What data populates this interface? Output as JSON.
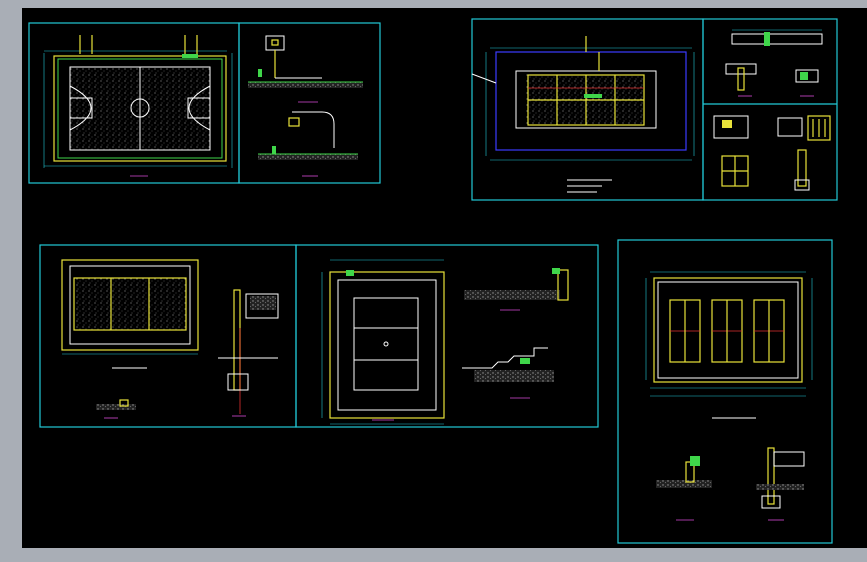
{
  "app": {
    "title": "",
    "canvas_background": "#000000",
    "window_background": "#a9aeb6"
  },
  "colors": {
    "frame": "#22c9d6",
    "court_outline": "#e8e23a",
    "green": "#3fd64a",
    "white": "#ffffff",
    "magenta": "#d94cd9",
    "red": "#e03030",
    "blue": "#3b3bff"
  },
  "sheets": [
    {
      "id": "basketball-court-plan",
      "icon": "cad-drawing-sheet"
    },
    {
      "id": "basketball-hoop-elevation",
      "icon": "cad-drawing-sheet"
    },
    {
      "id": "tennis-court-site-plan",
      "icon": "cad-drawing-sheet"
    },
    {
      "id": "fence-details",
      "icon": "cad-drawing-sheet"
    },
    {
      "id": "volleyball-court-plan",
      "icon": "cad-drawing-sheet"
    },
    {
      "id": "volleyball-court-layout",
      "icon": "cad-drawing-sheet"
    },
    {
      "id": "multi-court-plan",
      "icon": "cad-drawing-sheet"
    }
  ]
}
